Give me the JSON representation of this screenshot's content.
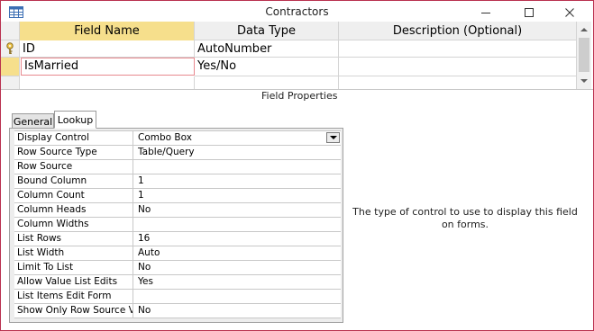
{
  "window": {
    "title": "Contractors",
    "border_color": "#b9314f",
    "icon": "table-icon",
    "controls": [
      "minimize-icon",
      "maximize-icon",
      "close-icon"
    ]
  },
  "grid": {
    "headers": {
      "field_name": "Field Name",
      "data_type": "Data Type",
      "description": "Description (Optional)"
    },
    "header_bg": "#f6df8c",
    "rows": [
      {
        "field_name": "ID",
        "data_type": "AutoNumber",
        "description": "",
        "primary_key": true
      },
      {
        "field_name": "IsMarried",
        "data_type": "Yes/No",
        "description": "",
        "selected": true
      },
      {
        "field_name": "",
        "data_type": "",
        "description": ""
      }
    ]
  },
  "field_properties": {
    "label": "Field Properties",
    "tabs": [
      "General",
      "Lookup"
    ],
    "active_tab": "Lookup",
    "rows": [
      {
        "name": "Display Control",
        "value": "Combo Box",
        "dropdown": true
      },
      {
        "name": "Row Source Type",
        "value": "Table/Query"
      },
      {
        "name": "Row Source",
        "value": ""
      },
      {
        "name": "Bound Column",
        "value": "1"
      },
      {
        "name": "Column Count",
        "value": "1"
      },
      {
        "name": "Column Heads",
        "value": "No"
      },
      {
        "name": "Column Widths",
        "value": ""
      },
      {
        "name": "List Rows",
        "value": "16"
      },
      {
        "name": "List Width",
        "value": "Auto"
      },
      {
        "name": "Limit To List",
        "value": "No"
      },
      {
        "name": "Allow Value List Edits",
        "value": "Yes"
      },
      {
        "name": "List Items Edit Form",
        "value": ""
      },
      {
        "name": "Show Only Row Source Values",
        "value": "No"
      }
    ],
    "help_text": "The type of control to use to display this field on forms."
  }
}
